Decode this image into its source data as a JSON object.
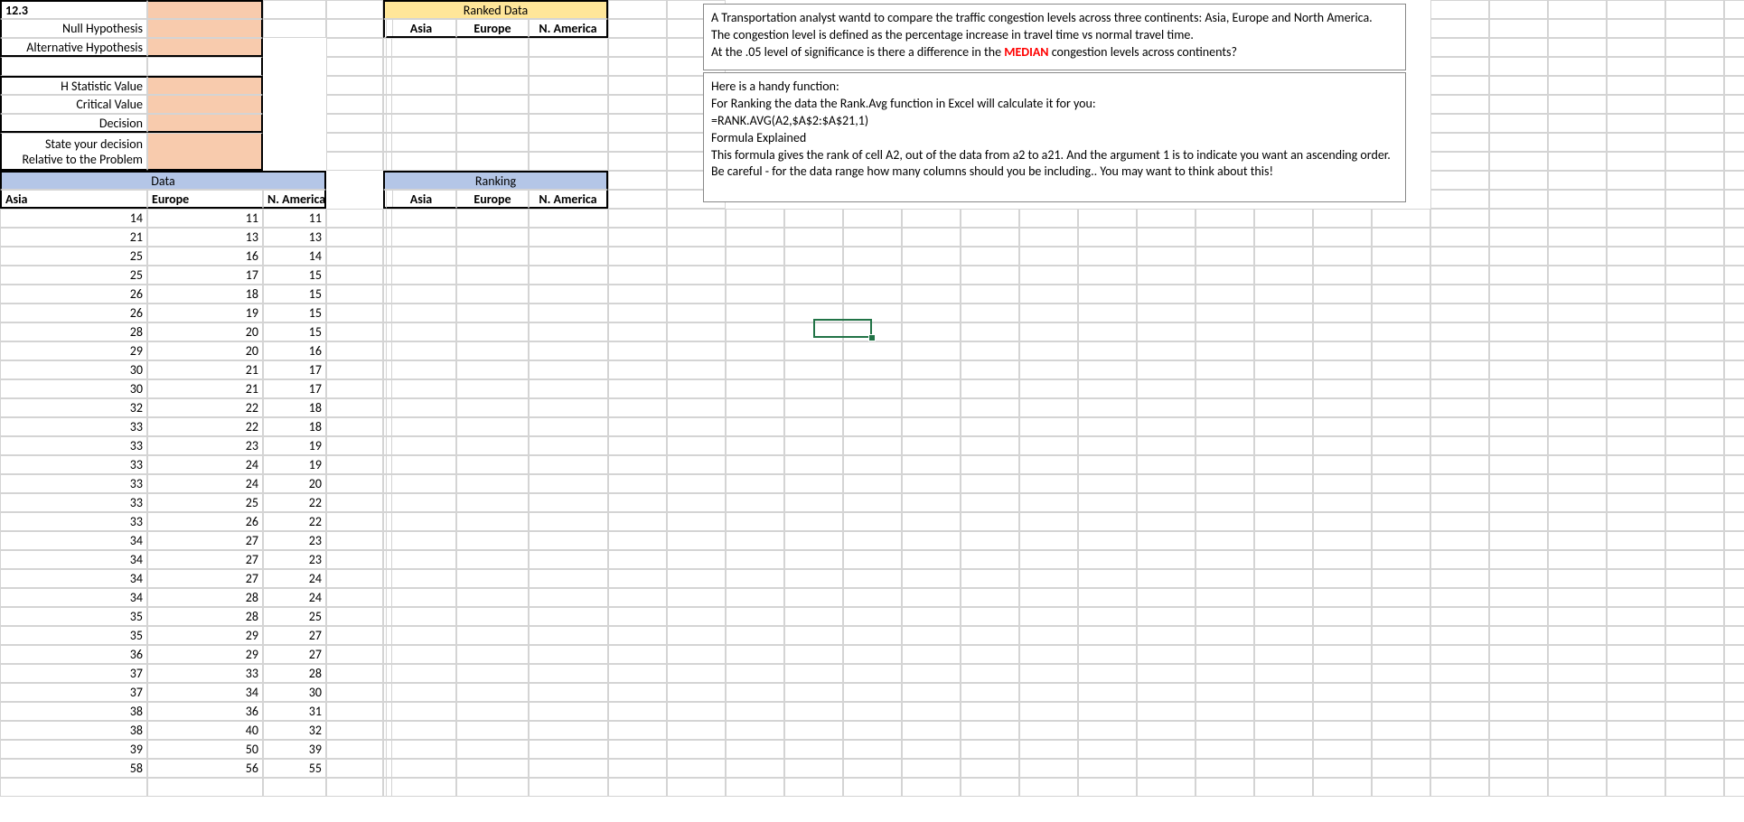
{
  "topLeftLabel": "12.3",
  "hypothesis": {
    "nullLabel": "Null Hypothesis",
    "altLabel": "Alternative Hypothesis",
    "hstatLabel": "H Statistic Value",
    "critLabel": "Critical Value",
    "decisionLabel": "Decision",
    "relativeLabel": "State your decision Relative to the Problem"
  },
  "headers": {
    "ranked_data": "Ranked Data",
    "data": "Data",
    "ranking": "Ranking",
    "asia": "Asia",
    "europe": "Europe",
    "namerica": "N. America"
  },
  "data": {
    "asia": [
      14,
      21,
      25,
      25,
      26,
      26,
      28,
      29,
      30,
      30,
      32,
      33,
      33,
      33,
      33,
      33,
      33,
      34,
      34,
      34,
      34,
      35,
      35,
      36,
      37,
      37,
      38,
      38,
      39,
      58
    ],
    "europe": [
      11,
      13,
      16,
      17,
      18,
      19,
      20,
      20,
      21,
      21,
      22,
      22,
      23,
      24,
      24,
      25,
      26,
      27,
      27,
      27,
      28,
      28,
      29,
      29,
      33,
      34,
      36,
      40,
      50,
      56
    ],
    "namerica": [
      11,
      13,
      14,
      15,
      15,
      15,
      15,
      16,
      17,
      17,
      18,
      18,
      19,
      19,
      20,
      22,
      22,
      23,
      23,
      24,
      24,
      25,
      27,
      27,
      28,
      30,
      31,
      32,
      39,
      55
    ]
  },
  "textbox1": {
    "line1": "A Transportation analyst wantd to compare the traffic congestion levels across three continents:  Asia, Europe and North America.",
    "line2": "The congestion level is defined as the percentage increase in travel time vs normal travel time.",
    "line3a": "At the .05 level of significance is there a difference in the ",
    "median": "MEDIAN",
    "line3b": " congestion levels across continents?"
  },
  "textbox2": {
    "l1": "Here is a handy function:",
    "l2": " For Ranking the data the Rank.Avg function in Excel will calculate it for you:",
    "l3": "=RANK.AVG(A2,$A$2:$A$21,1)",
    "l4": "Formula Explained",
    "l5": "This formula gives the rank of cell A2, out of the data from a2 to a21.  And the argument 1 is to indicate you want an ascending order.",
    "l6": "Be careful - for the data range how many columns should you be including.. You may want to think about this!"
  }
}
